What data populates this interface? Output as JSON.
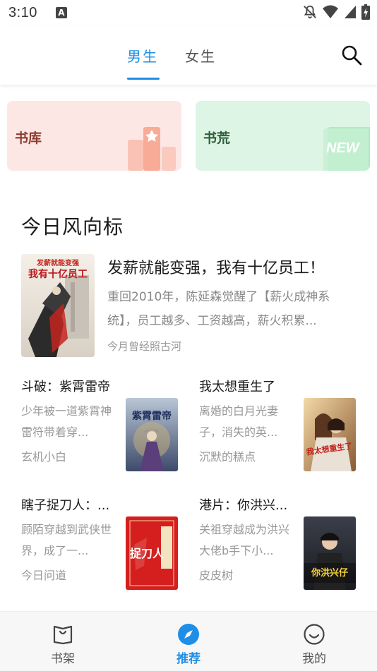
{
  "status_bar": {
    "time": "3:10",
    "notification_letter": "A"
  },
  "header": {
    "tabs": [
      {
        "label": "男生",
        "active": true
      },
      {
        "label": "女生",
        "active": false
      }
    ],
    "accent_color": "#1E8EE6"
  },
  "categories": [
    {
      "label": "书库",
      "background": "#FDE7E5"
    },
    {
      "label": "书荒",
      "background": "#DDF5E4",
      "badge": "NEW"
    }
  ],
  "section": {
    "title": "今日风向标",
    "featured": {
      "title": "发薪就能变强，我有十亿员工！",
      "description": "重回2010年，陈延森觉醒了【薪火成神系统】，员工越多、工资越高，薪火积累...",
      "author": "今月曾经照古河",
      "cover_text": [
        "发薪就能变强",
        "我有十亿员工"
      ]
    },
    "books": [
      {
        "title": "斗破：紫霄雷帝",
        "description": "少年被一道紫霄神雷符带着穿...",
        "author": "玄机小白",
        "cover_text": "紫霄雷帝"
      },
      {
        "title": "我太想重生了",
        "description": "离婚的白月光妻子，消失的英...",
        "author": "沉默的糕点",
        "cover_text": "我太想重生了"
      },
      {
        "title": "瞎子捉刀人：...",
        "description": "顾陌穿越到武侠世界，成了一...",
        "author": "今日问道",
        "cover_text": "捉刀人"
      },
      {
        "title": "港片：你洪兴...",
        "description": "关祖穿越成为洪兴大佬b手下小...",
        "author": "皮皮树",
        "cover_text": "你洪兴仔"
      }
    ]
  },
  "bottom_nav": [
    {
      "label": "书架",
      "active": false
    },
    {
      "label": "推荐",
      "active": true
    },
    {
      "label": "我的",
      "active": false
    }
  ]
}
